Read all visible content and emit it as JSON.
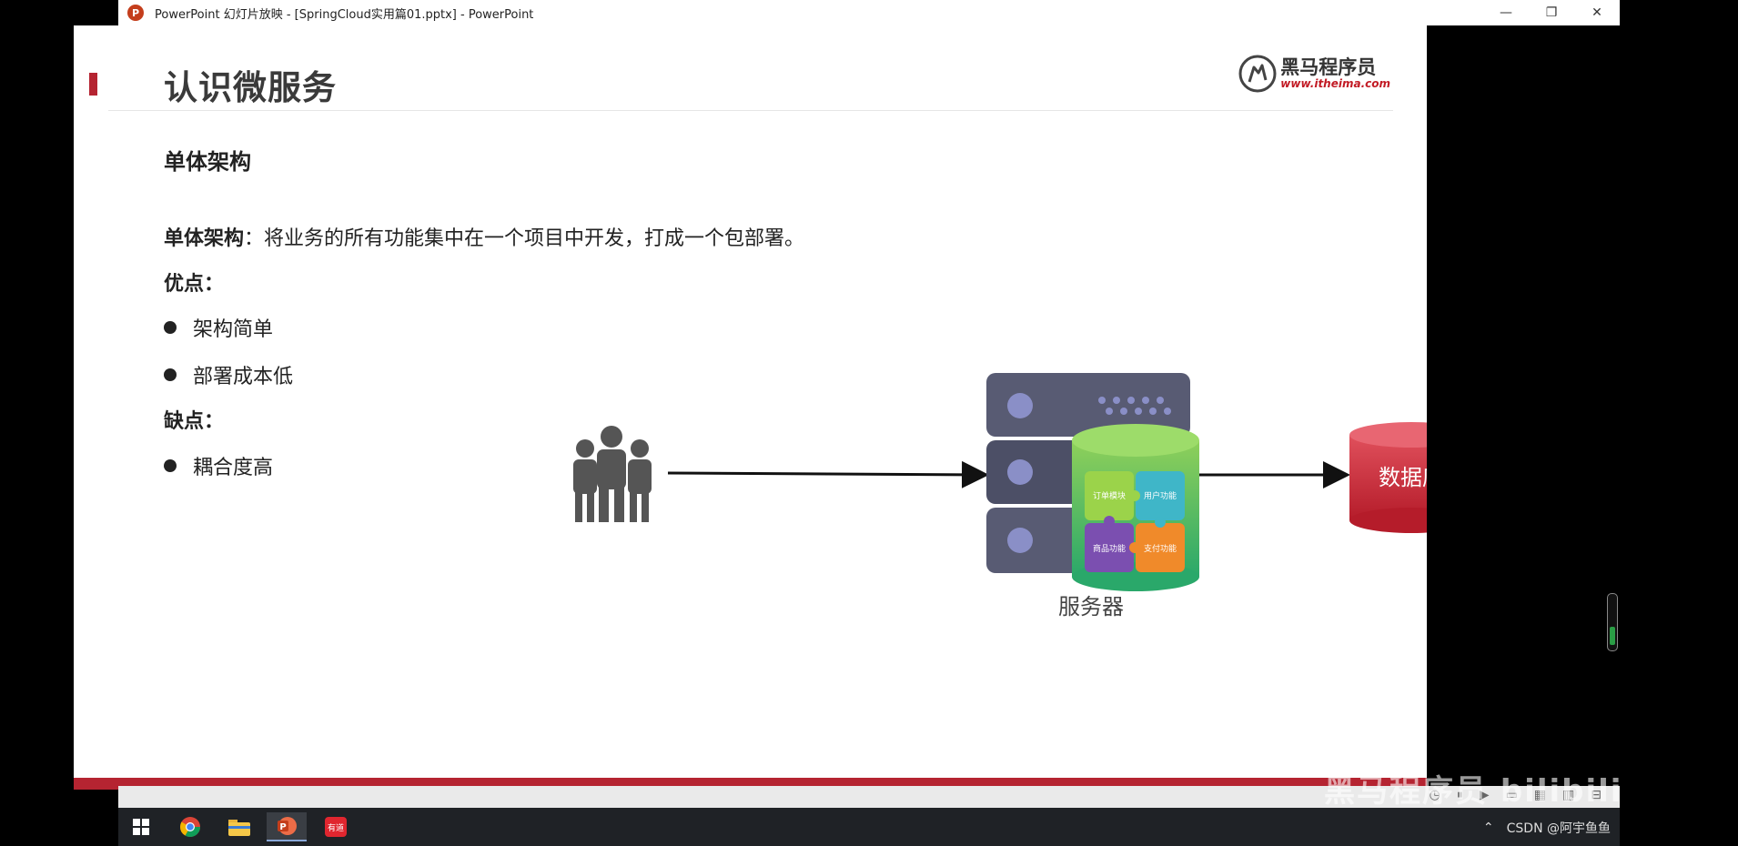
{
  "window": {
    "title": "PowerPoint 幻灯片放映 - [SpringCloud实用篇01.pptx] - PowerPoint",
    "app_icon": "P",
    "controls": {
      "minimize": "—",
      "maximize": "❐",
      "close": "✕"
    }
  },
  "slide": {
    "title": "认识微服务",
    "logo": {
      "name": "黑马程序员",
      "url": "www.itheima.com"
    },
    "section_title": "单体架构",
    "definition": {
      "term": "单体架构",
      "colon": "：",
      "text": "将业务的所有功能集中在一个项目中开发，打成一个包部署。"
    },
    "pros": {
      "title": "优点：",
      "items": [
        "架构简单",
        "部署成本低"
      ]
    },
    "cons": {
      "title": "缺点：",
      "items": [
        "耦合度高"
      ]
    },
    "diagram": {
      "server_label": "服务器",
      "database_label": "数据库",
      "modules": [
        "订单模块",
        "用户功能",
        "商品功能",
        "支付功能"
      ]
    },
    "accent_color": "#b52431"
  },
  "overlay": {
    "watermark": "黑马程序员 bilibili"
  },
  "taskbar": {
    "items": [
      "windows-start-icon",
      "chrome-icon",
      "file-explorer-icon",
      "powerpoint-icon",
      "youdao-icon"
    ],
    "youdao_label": "有道",
    "tray_text": "CSDN @阿宇鱼鱼"
  }
}
